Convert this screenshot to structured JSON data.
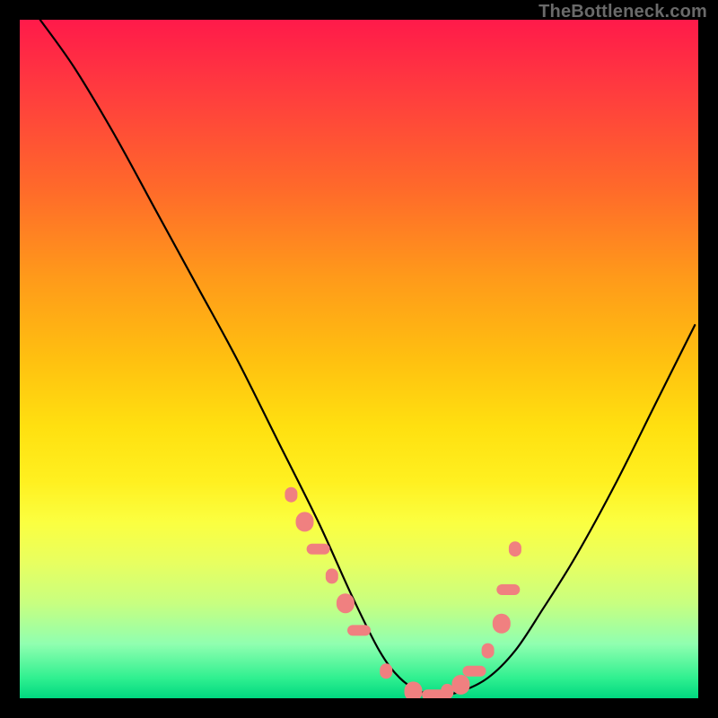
{
  "watermark": "TheBottleneck.com",
  "chart_data": {
    "type": "line",
    "title": "",
    "xlabel": "",
    "ylabel": "",
    "xlim": [
      0,
      100
    ],
    "ylim": [
      0,
      100
    ],
    "grid": false,
    "legend": false,
    "series": [
      {
        "name": "curve",
        "x": [
          3,
          8,
          14,
          20,
          26,
          32,
          38,
          44,
          49,
          53,
          56,
          59,
          62,
          65,
          69,
          73,
          77,
          82,
          88,
          94,
          99.5
        ],
        "y": [
          100,
          93,
          83,
          72,
          61,
          50,
          38,
          26,
          15,
          7,
          3,
          1,
          0.5,
          1,
          3,
          7,
          13,
          21,
          32,
          44,
          55
        ]
      }
    ],
    "markers": {
      "name": "highlight-dots",
      "color": "#f08080",
      "x": [
        40,
        42,
        44,
        46,
        48,
        50,
        54,
        58,
        61,
        63,
        65,
        67,
        69,
        71,
        72,
        73
      ],
      "y": [
        30,
        26,
        22,
        18,
        14,
        10,
        4,
        1,
        0.5,
        1,
        2,
        4,
        7,
        11,
        16,
        22
      ]
    }
  }
}
